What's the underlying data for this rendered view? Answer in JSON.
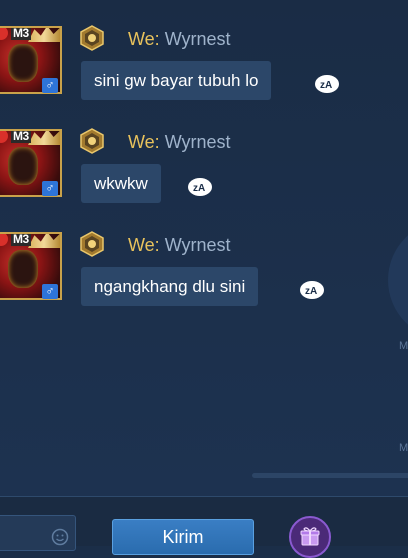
{
  "messages": [
    {
      "avatar_badge": "M3",
      "gender_symbol": "♂",
      "sender_prefix": "We:",
      "sender_name": "Wyrnest",
      "text": "sini gw bayar tubuh lo",
      "icons": [
        "rank-badge-icon",
        "translate-icon"
      ]
    },
    {
      "avatar_badge": "M3",
      "gender_symbol": "♂",
      "sender_prefix": "We:",
      "sender_name": "Wyrnest",
      "text": "wkwkw",
      "icons": [
        "rank-badge-icon",
        "translate-icon"
      ]
    },
    {
      "avatar_badge": "M3",
      "gender_symbol": "♂",
      "sender_prefix": "We:",
      "sender_name": "Wyrnest",
      "text": "ngangkhang dlu sini",
      "icons": [
        "rank-badge-icon",
        "translate-icon"
      ]
    }
  ],
  "background_labels": [
    "M",
    "M"
  ],
  "input": {
    "value": "",
    "icon": "emoji-icon"
  },
  "send_button": {
    "label": "Kirim"
  },
  "gift_button": {
    "icon": "gift-icon"
  },
  "colors": {
    "background": "#1b2e48",
    "bubble": "#2c4769",
    "sender_prefix": "#e8c25c",
    "sender_name": "#9fb3cb",
    "send_button": "#3178be",
    "gift_button": "#4b2a78"
  }
}
